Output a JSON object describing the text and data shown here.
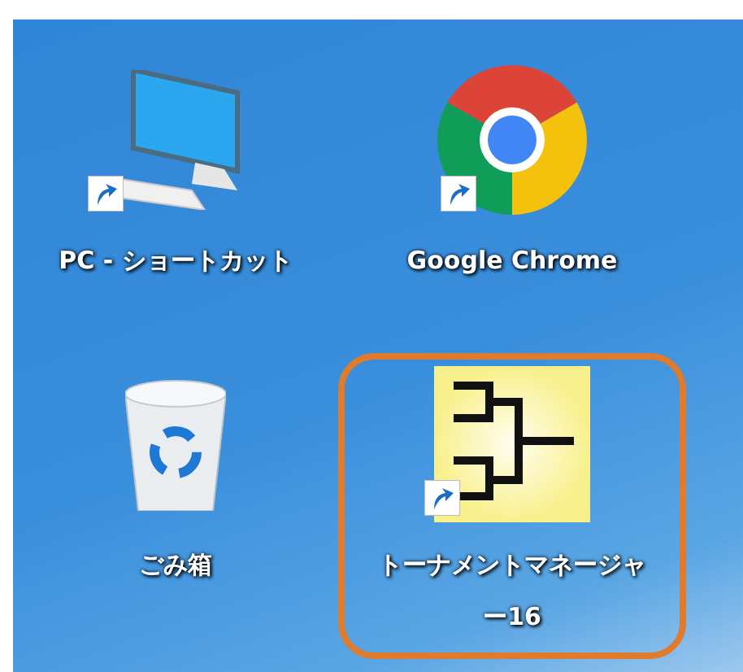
{
  "desktop": {
    "icons": [
      {
        "kind": "computer",
        "label": "PC - ショートカット",
        "shortcut": true,
        "selected": false
      },
      {
        "kind": "chrome",
        "label": "Google Chrome",
        "shortcut": true,
        "selected": false
      },
      {
        "kind": "recycle-bin",
        "label": "ごみ箱",
        "shortcut": false,
        "selected": false
      },
      {
        "kind": "bracket",
        "label": "トーナメントマネージャー16",
        "shortcut": true,
        "selected": true
      }
    ]
  }
}
